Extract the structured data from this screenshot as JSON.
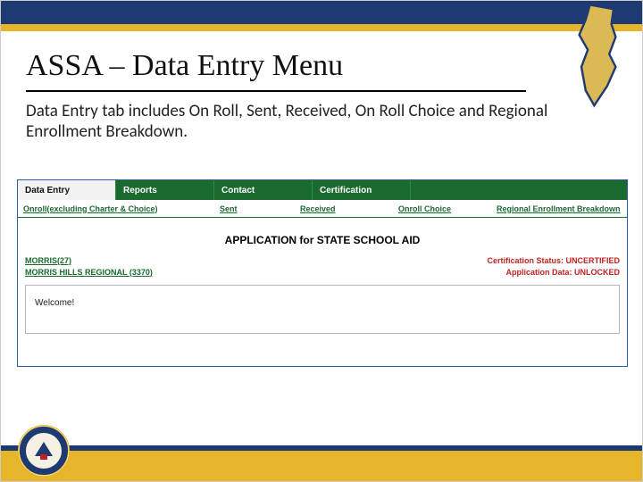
{
  "slide": {
    "title": "ASSA – Data Entry Menu",
    "description": "Data Entry tab includes On Roll, Sent, Received, On Roll Choice and Regional Enrollment Breakdown."
  },
  "app": {
    "tabs": [
      "Data Entry",
      "Reports",
      "Contact",
      "Certification"
    ],
    "activeTabIndex": 0,
    "subnav": [
      "Onroll(excluding Charter & Choice)",
      "Sent",
      "Received",
      "Onroll Choice",
      "Regional Enrollment Breakdown"
    ],
    "heading": "APPLICATION for STATE SCHOOL AID",
    "breadcrumbs": [
      "MORRIS(27)",
      "MORRIS HILLS REGIONAL (3370)"
    ],
    "status": {
      "cert": "Certification Status: UNCERTIFIED",
      "lock": "Application Data: UNLOCKED"
    },
    "welcome": "Welcome!"
  },
  "icons": {
    "nj": "nj-state-silhouette",
    "seal": "nj-doe-seal"
  },
  "colors": {
    "navy": "#1e3a72",
    "gold": "#e7b52a",
    "green": "#1a6a2f",
    "red": "#c22020"
  }
}
